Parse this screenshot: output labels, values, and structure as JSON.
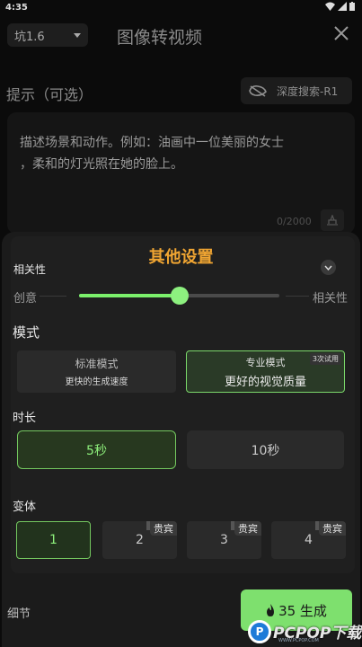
{
  "status": {
    "time": "4:35"
  },
  "header": {
    "model_select": "坑1.6",
    "title": "图像转视频"
  },
  "prompt": {
    "label": "提示（可选）",
    "deep_search_label": "深度搜索-R1",
    "placeholder_line1": "描述场景和动作。例如：油画中一位美丽的女士",
    "placeholder_line2": "，柔和的灯光照在她的脸上。",
    "char_count": "0/2000"
  },
  "settings": {
    "title": "其他设置",
    "relevance_label": "相关性",
    "slider": {
      "left_label": "创意",
      "right_label": "相关性",
      "value": 0.5
    },
    "mode": {
      "label": "模式",
      "options": [
        {
          "name": "标准模式",
          "sub": "更快的生成速度",
          "selected": false
        },
        {
          "name": "专业模式",
          "sub": "更好的视觉质量",
          "selected": true,
          "badge": "3次试用"
        }
      ]
    },
    "duration": {
      "label": "时长",
      "options": [
        {
          "label": "5秒",
          "selected": true
        },
        {
          "label": "10秒",
          "selected": false
        }
      ]
    },
    "variants": {
      "label": "变体",
      "options": [
        {
          "label": "1",
          "selected": true,
          "badge": ""
        },
        {
          "label": "2",
          "selected": false,
          "badge": "贵宾"
        },
        {
          "label": "3",
          "selected": false,
          "badge": "贵宾"
        },
        {
          "label": "4",
          "selected": false,
          "badge": "贵宾"
        }
      ]
    }
  },
  "footer": {
    "detail_label": "细节",
    "generate_label": "35 生成",
    "watermark_text": "PCPOP下载",
    "watermark_sub": "WWW.PCPOP.COM"
  },
  "colors": {
    "accent": "#7ee06e",
    "title_orange": "#f0a532"
  }
}
